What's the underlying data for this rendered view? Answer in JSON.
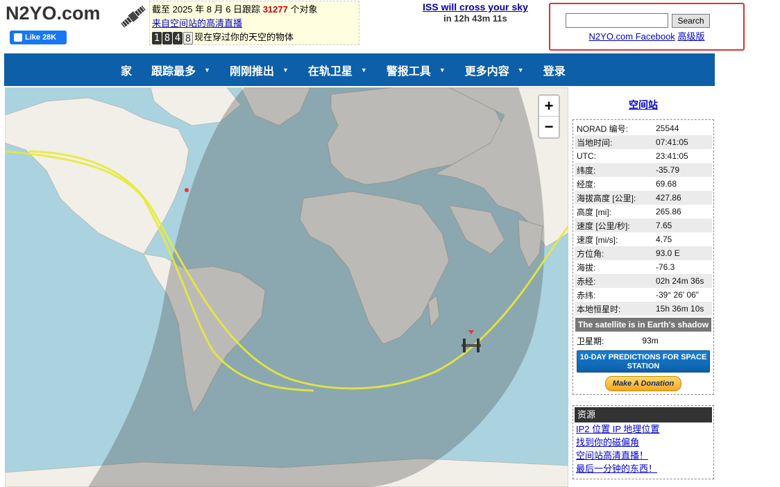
{
  "header": {
    "logo_text": "N2YO.com",
    "fb_like_label": "Like 28K",
    "ticker": {
      "line1_prefix": "截至 2025 年 8 月 6 日跟踪",
      "tracked_count": "31277",
      "line1_suffix": "个对象",
      "live_link": "来自空间站的高清直播",
      "counter_digits": [
        "1",
        ",",
        "8",
        "4",
        "8"
      ],
      "line3_text": "现在穿过你的天空的物体"
    },
    "iss_cross": {
      "link": "ISS will cross your sky",
      "countdown": "in 12h 43m 11s"
    },
    "search": {
      "input_value": "",
      "button_label": "Search",
      "links": [
        "N2YO.com Facebook",
        "高级版"
      ]
    }
  },
  "nav": {
    "items": [
      {
        "label": "家",
        "dropdown": false
      },
      {
        "label": "跟踪最多",
        "dropdown": true
      },
      {
        "label": "刚刚推出",
        "dropdown": true
      },
      {
        "label": "在轨卫星",
        "dropdown": true
      },
      {
        "label": "警报工具",
        "dropdown": true
      },
      {
        "label": "更多内容",
        "dropdown": true
      },
      {
        "label": "登录",
        "dropdown": false
      }
    ]
  },
  "map": {
    "zoom_in": "+",
    "zoom_out": "−",
    "colors": {
      "ocean": "#aad3df",
      "land": "#f2efe9",
      "night": "#4a4a4a",
      "track": "#e6ea3a",
      "marker": "#e53935"
    }
  },
  "side": {
    "title": "空间站",
    "info_rows": [
      {
        "k": "NORAD 编号:",
        "v": "25544"
      },
      {
        "k": "当地时间:",
        "v": "07:41:05"
      },
      {
        "k": "UTC:",
        "v": "23:41:05"
      },
      {
        "k": "纬度:",
        "v": "-35.79"
      },
      {
        "k": "经度:",
        "v": "69.68"
      },
      {
        "k": "海拔高度 [公里]:",
        "v": "427.86"
      },
      {
        "k": "高度 [mi]:",
        "v": "265.86"
      },
      {
        "k": "速度 [公里/秒]:",
        "v": "7.65"
      },
      {
        "k": "速度 [mi/s]:",
        "v": "4.75"
      },
      {
        "k": "方位角:",
        "v": "93.0 E"
      },
      {
        "k": "海拔:",
        "v": "-76.3"
      },
      {
        "k": "赤经:",
        "v": "02h 24m 36s"
      },
      {
        "k": "赤纬:",
        "v": "-39° 26' 06\""
      },
      {
        "k": "本地恒星时:",
        "v": "15h 36m 10s"
      }
    ],
    "shadow_status": "The satellite is in Earth's shadow",
    "period_label": "卫星期:",
    "period_value": "93m",
    "predictions_button": "10-DAY PREDICTIONS FOR SPACE STATION",
    "donate_button": "Make A Donation",
    "resources": {
      "title": "资源",
      "links": [
        "IP2 位置 IP 地理位置",
        "找到你的磁偏角",
        "空间站高清直播！",
        "最后一分钟的东西！"
      ]
    }
  }
}
